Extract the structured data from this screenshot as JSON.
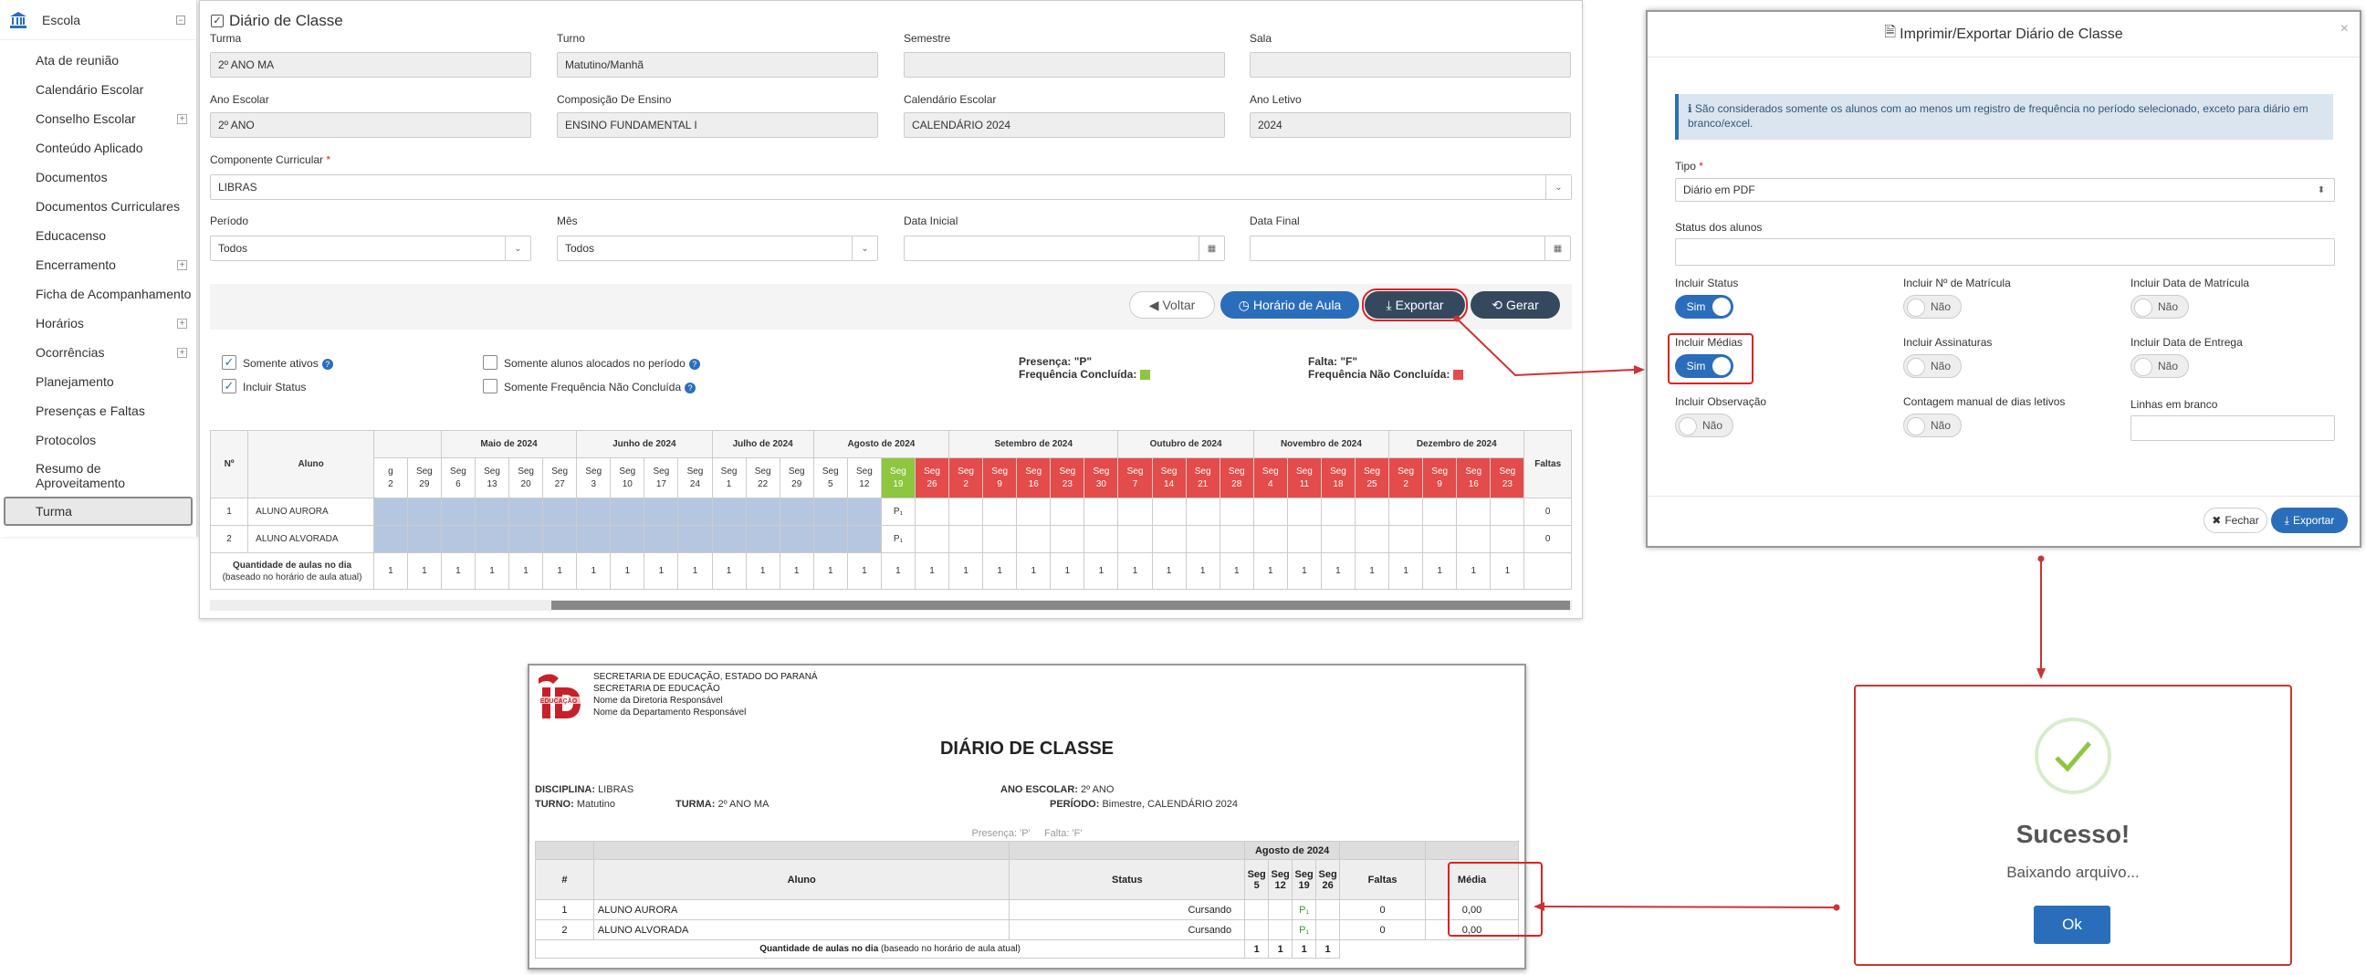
{
  "sidebar": {
    "header": "Escola",
    "items": [
      {
        "label": "Ata de reunião",
        "plus": false
      },
      {
        "label": "Calendário Escolar",
        "plus": false
      },
      {
        "label": "Conselho Escolar",
        "plus": true
      },
      {
        "label": "Conteúdo Aplicado",
        "plus": false
      },
      {
        "label": "Documentos",
        "plus": false
      },
      {
        "label": "Documentos Curriculares",
        "plus": false
      },
      {
        "label": "Educacenso",
        "plus": false
      },
      {
        "label": "Encerramento",
        "plus": true
      },
      {
        "label": "Ficha de Acompanhamento",
        "plus": false
      },
      {
        "label": "Horários",
        "plus": true
      },
      {
        "label": "Ocorrências",
        "plus": true
      },
      {
        "label": "Planejamento",
        "plus": false
      },
      {
        "label": "Presenças e Faltas",
        "plus": false
      },
      {
        "label": "Protocolos",
        "plus": false
      },
      {
        "label": "Resumo de Aproveitamento",
        "plus": false
      },
      {
        "label": "Turma",
        "plus": false,
        "active": true
      }
    ]
  },
  "form": {
    "title": "Diário de Classe",
    "turma_label": "Turma",
    "turma": "2º ANO MA",
    "turno_label": "Turno",
    "turno": "Matutino/Manhã",
    "semestre_label": "Semestre",
    "semestre": "",
    "sala_label": "Sala",
    "sala": "",
    "ano_escolar_label": "Ano Escolar",
    "ano_escolar": "2º ANO",
    "composicao_label": "Composição De Ensino",
    "composicao": "ENSINO FUNDAMENTAL I",
    "calendario_label": "Calendário Escolar",
    "calendario": "CALENDÁRIO 2024",
    "ano_letivo_label": "Ano Letivo",
    "ano_letivo": "2024",
    "componente_label": "Componente Curricular",
    "componente": "LIBRAS",
    "periodo_label": "Período",
    "periodo": "Todos",
    "mes_label": "Mês",
    "mes": "Todos",
    "data_inicial_label": "Data Inicial",
    "data_final_label": "Data Final"
  },
  "buttons": {
    "voltar": "Voltar",
    "horario": "Horário de Aula",
    "exportar": "Exportar",
    "gerar": "Gerar"
  },
  "filters": {
    "somente_ativos": "Somente ativos",
    "incluir_status": "Incluir Status",
    "somente_alocados": "Somente alunos alocados no período",
    "somente_freq": "Somente Frequência Não Concluída",
    "presenca": "Presença: \"P\"",
    "freq_concluida": "Frequência Concluída:",
    "falta": "Falta: \"F\"",
    "freq_nao_concluida": "Frequência Não Concluída:"
  },
  "attendance": {
    "col_n": "Nº",
    "col_aluno": "Aluno",
    "col_faltas": "Faltas",
    "months": [
      {
        "name": "",
        "span": 2
      },
      {
        "name": "Maio de 2024",
        "span": 4
      },
      {
        "name": "Junho de 2024",
        "span": 4
      },
      {
        "name": "Julho de 2024",
        "span": 3
      },
      {
        "name": "Agosto de 2024",
        "span": 4
      },
      {
        "name": "Setembro de 2024",
        "span": 5
      },
      {
        "name": "Outubro de 2024",
        "span": 4
      },
      {
        "name": "Novembro de 2024",
        "span": 4
      },
      {
        "name": "Dezembro de 2024",
        "span": 4
      }
    ],
    "days": [
      {
        "w": "g",
        "d": "2",
        "c": ""
      },
      {
        "w": "Seg",
        "d": "29",
        "c": ""
      },
      {
        "w": "Seg",
        "d": "6",
        "c": ""
      },
      {
        "w": "Seg",
        "d": "13",
        "c": ""
      },
      {
        "w": "Seg",
        "d": "20",
        "c": ""
      },
      {
        "w": "Seg",
        "d": "27",
        "c": ""
      },
      {
        "w": "Seg",
        "d": "3",
        "c": ""
      },
      {
        "w": "Seg",
        "d": "10",
        "c": ""
      },
      {
        "w": "Seg",
        "d": "17",
        "c": ""
      },
      {
        "w": "Seg",
        "d": "24",
        "c": ""
      },
      {
        "w": "Seg",
        "d": "1",
        "c": ""
      },
      {
        "w": "Seg",
        "d": "22",
        "c": ""
      },
      {
        "w": "Seg",
        "d": "29",
        "c": ""
      },
      {
        "w": "Seg",
        "d": "5",
        "c": ""
      },
      {
        "w": "Seg",
        "d": "12",
        "c": ""
      },
      {
        "w": "Seg",
        "d": "19",
        "c": "grn"
      },
      {
        "w": "Seg",
        "d": "26",
        "c": "red"
      },
      {
        "w": "Seg",
        "d": "2",
        "c": "red"
      },
      {
        "w": "Seg",
        "d": "9",
        "c": "red"
      },
      {
        "w": "Seg",
        "d": "16",
        "c": "red"
      },
      {
        "w": "Seg",
        "d": "23",
        "c": "red"
      },
      {
        "w": "Seg",
        "d": "30",
        "c": "red"
      },
      {
        "w": "Seg",
        "d": "7",
        "c": "red"
      },
      {
        "w": "Seg",
        "d": "14",
        "c": "red"
      },
      {
        "w": "Seg",
        "d": "21",
        "c": "red"
      },
      {
        "w": "Seg",
        "d": "28",
        "c": "red"
      },
      {
        "w": "Seg",
        "d": "4",
        "c": "red"
      },
      {
        "w": "Seg",
        "d": "11",
        "c": "red"
      },
      {
        "w": "Seg",
        "d": "18",
        "c": "red"
      },
      {
        "w": "Seg",
        "d": "25",
        "c": "red"
      },
      {
        "w": "Seg",
        "d": "2",
        "c": "red"
      },
      {
        "w": "Seg",
        "d": "9",
        "c": "red"
      },
      {
        "w": "Seg",
        "d": "16",
        "c": "red"
      },
      {
        "w": "Seg",
        "d": "23",
        "c": "red"
      }
    ],
    "students": [
      {
        "n": "1",
        "name": "ALUNO AURORA",
        "mark": "P₁",
        "faltas": "0"
      },
      {
        "n": "2",
        "name": "ALUNO ALVORADA",
        "mark": "P₁",
        "faltas": "0"
      }
    ],
    "qty_label": "Quantidade de aulas no dia",
    "qty_sub": "(baseado no horário de aula atual)",
    "qty_value": "1"
  },
  "modal": {
    "title": "Imprimir/Exportar Diário de Classe",
    "close": "×",
    "info": "Só são considerados somente os alunos com ao menos um registro de frequência no período selecionado, exceto para diário em branco/excel.",
    "info_prefix": "São considerados somente os alunos com ao menos um registro de frequência no período selecionado, exceto para diário em branco/excel.",
    "tipo_label": "Tipo",
    "tipo": "Diário em PDF",
    "status_label": "Status dos alunos",
    "opts": [
      {
        "label": "Incluir Status",
        "value": "Sim",
        "on": true
      },
      {
        "label": "Incluir Nº de Matrícula",
        "value": "Não",
        "on": false
      },
      {
        "label": "Incluir Data de Matrícula",
        "value": "Não",
        "on": false
      },
      {
        "label": "Incluir Médias",
        "value": "Sim",
        "on": true
      },
      {
        "label": "Incluir Assinaturas",
        "value": "Não",
        "on": false
      },
      {
        "label": "Incluir Data de Entrega",
        "value": "Não",
        "on": false
      },
      {
        "label": "Incluir Observação",
        "value": "Não",
        "on": false
      },
      {
        "label": "Contagem manual de dias letivos",
        "value": "Não",
        "on": false
      }
    ],
    "linhas_label": "Linhas em branco",
    "fechar": "Fechar",
    "exportar": "Exportar"
  },
  "pdf": {
    "header_lines": [
      "SECRETARIA DE EDUCAÇÃO, ESTADO DO PARANÁ",
      "SECRETARIA DE EDUCAÇÃO",
      "Nome da Diretoria Responsável",
      "Nome da Departamento Responsável"
    ],
    "logo_text": "EDUCAÇÃO",
    "title": "DIÁRIO DE CLASSE",
    "disciplina_label": "DISCIPLINA:",
    "disciplina": "LIBRAS",
    "ano_label": "ANO ESCOLAR:",
    "ano": "2º ANO",
    "turno_label": "TURNO:",
    "turno": "Matutino",
    "turma_label": "TURMA:",
    "turma": "2º ANO MA",
    "periodo_label": "PERÍODO:",
    "periodo": "Bimestre, CALENDÁRIO 2024",
    "legend": "Presença: 'P'     Falta: 'F'",
    "month": "Agosto de 2024",
    "cols": {
      "n": "#",
      "aluno": "Aluno",
      "status": "Status",
      "faltas": "Faltas",
      "media": "Média"
    },
    "days": [
      {
        "w": "Seg",
        "d": "5"
      },
      {
        "w": "Seg",
        "d": "12"
      },
      {
        "w": "Seg",
        "d": "19"
      },
      {
        "w": "Seg",
        "d": "26"
      }
    ],
    "rows": [
      {
        "n": "1",
        "name": "ALUNO AURORA",
        "status": "Cursando",
        "mark": "P₁",
        "faltas": "0",
        "media": "0,00"
      },
      {
        "n": "2",
        "name": "ALUNO ALVORADA",
        "status": "Cursando",
        "mark": "P₁",
        "faltas": "0",
        "media": "0,00"
      }
    ],
    "qty_label": "Quantidade de aulas no dia",
    "qty_sub": "(baseado no horário de aula atual)",
    "qty": [
      "1",
      "1",
      "1",
      "1"
    ]
  },
  "success": {
    "title": "Sucesso!",
    "message": "Baixando arquivo...",
    "ok": "Ok"
  },
  "colors": {
    "primary": "#2a6ebb",
    "dark": "#34495e",
    "danger": "#e44b4b",
    "success": "#8dc63f"
  }
}
